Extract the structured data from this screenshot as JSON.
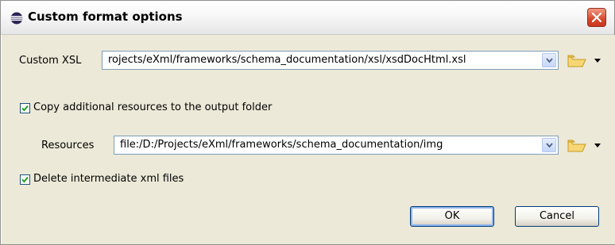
{
  "window": {
    "title": "Custom format options"
  },
  "form": {
    "custom_xsl_label": "Custom XSL",
    "custom_xsl_value": "rojects/eXml/frameworks/schema_documentation/xsl/xsdDocHtml.xsl",
    "copy_resources_label": "Copy additional resources to the output folder",
    "copy_resources_checked": true,
    "resources_label": "Resources",
    "resources_value": "file:/D:/Projects/eXml/frameworks/schema_documentation/img",
    "delete_intermediate_label": "Delete intermediate xml files",
    "delete_intermediate_checked": true
  },
  "buttons": {
    "ok": "OK",
    "cancel": "Cancel"
  },
  "icons": {
    "title": "eclipse-icon",
    "close": "close-icon",
    "folder": "folder-icon",
    "dropdown": "chevron-down-icon",
    "checkmark": "checkmark-icon"
  },
  "colors": {
    "dialog_bg": "#ece9d8",
    "close_button": "#d6472c",
    "input_border": "#7f9db9",
    "checkmark": "#21a121"
  }
}
